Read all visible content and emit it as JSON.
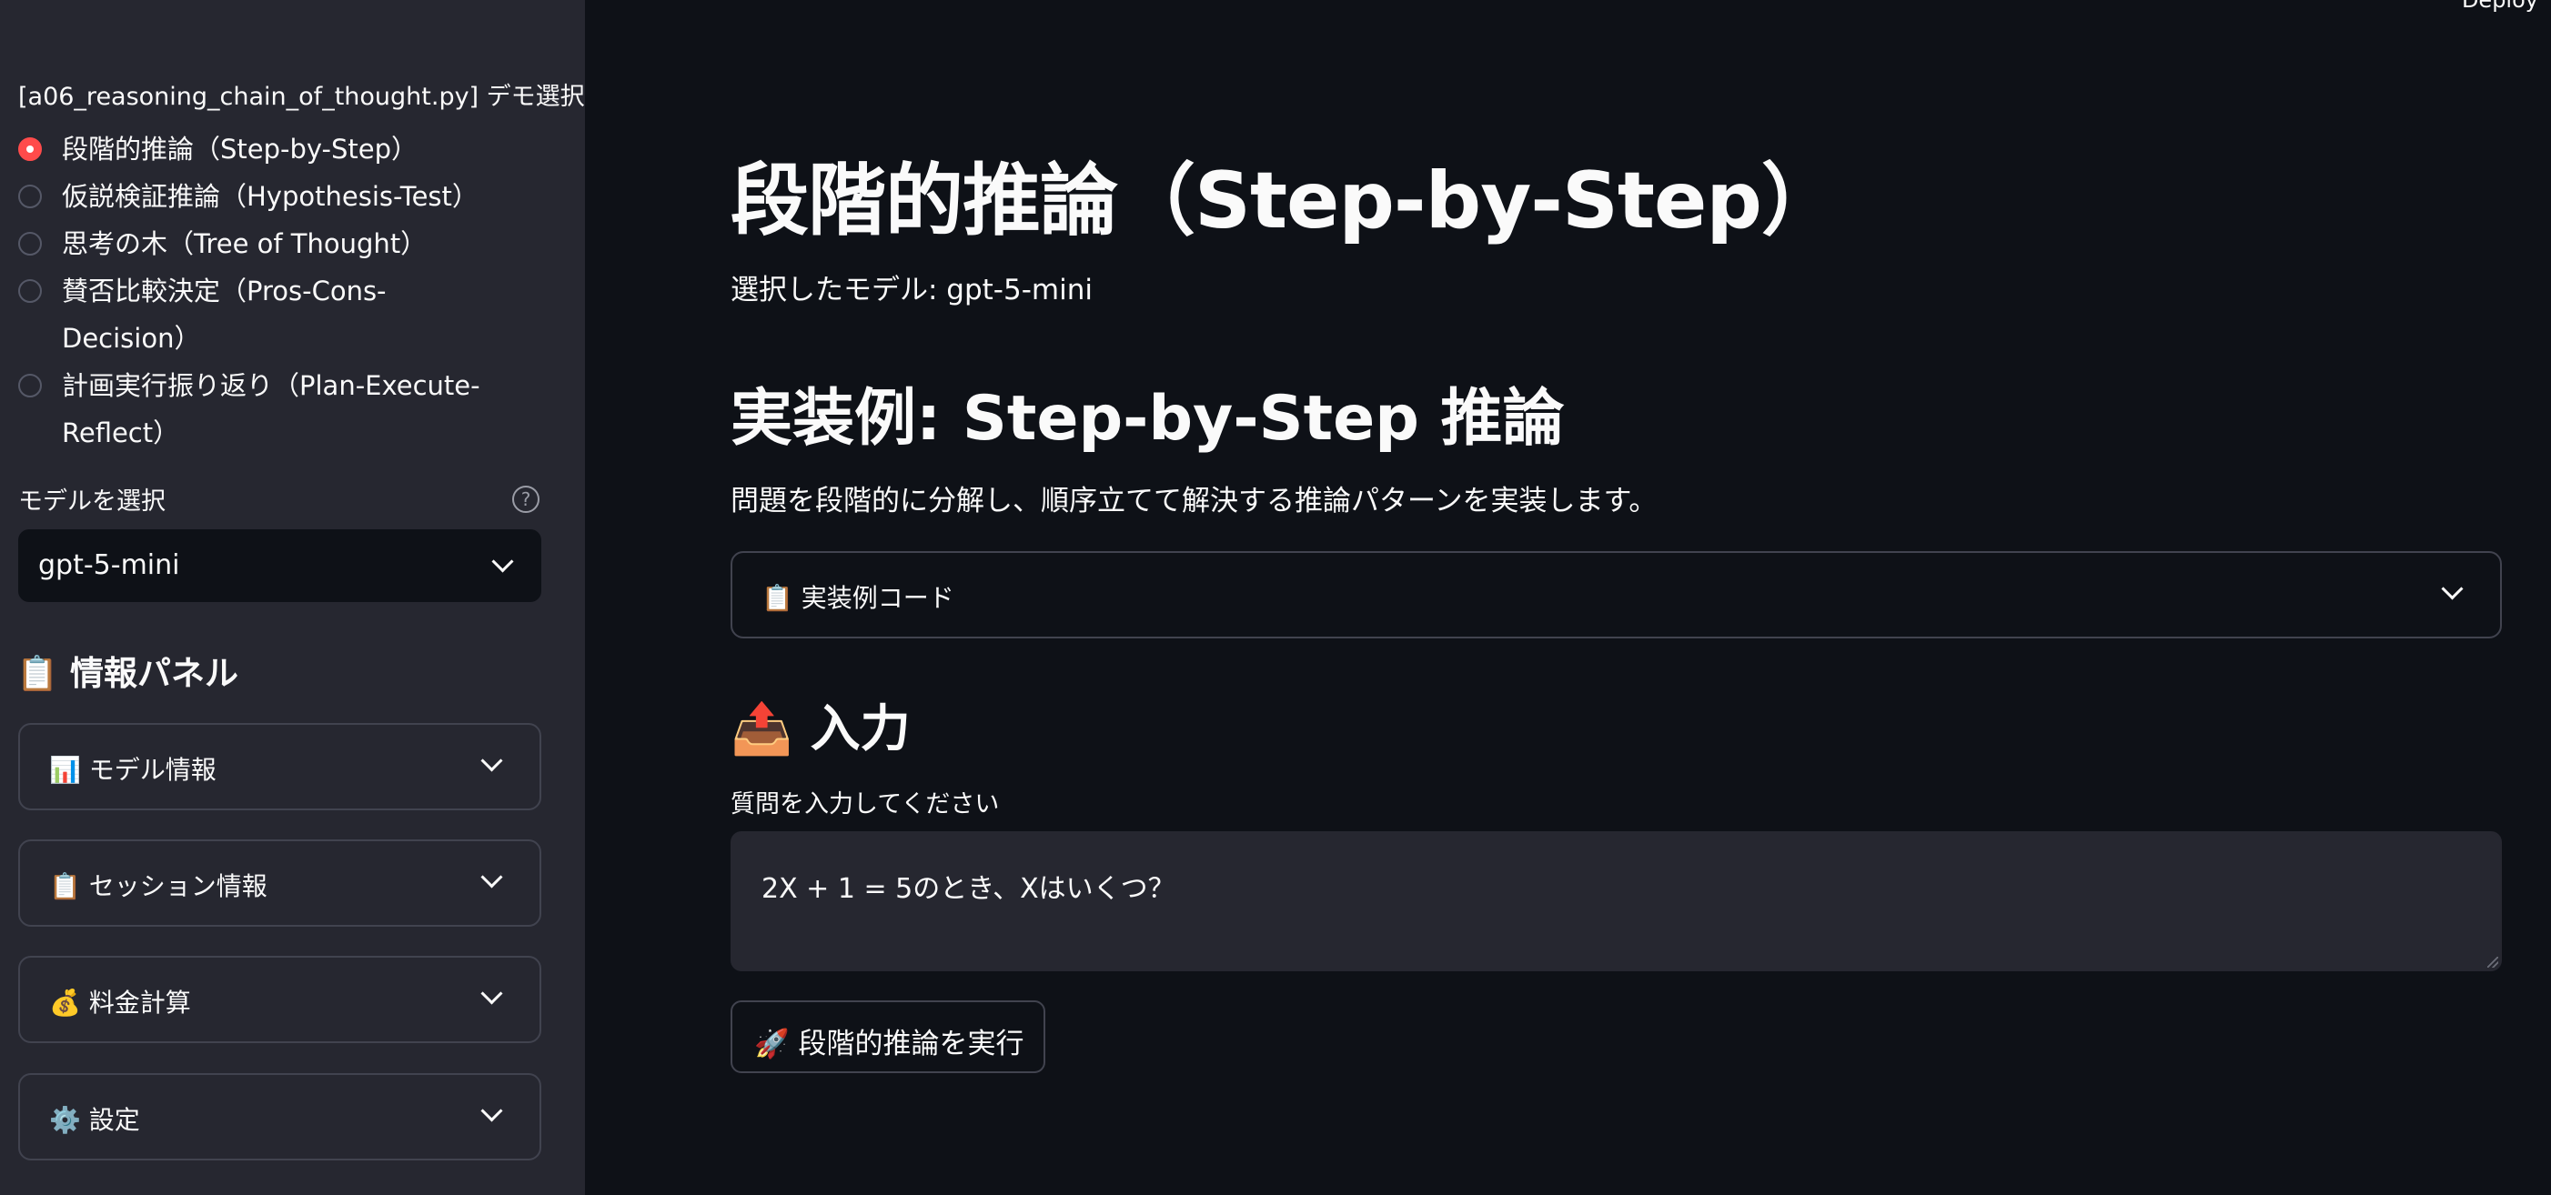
{
  "header": {
    "deploy_label": "Deploy"
  },
  "sidebar": {
    "demo_label": "[a06_reasoning_chain_of_thought.py] デモ選択",
    "demos": [
      {
        "label": "段階的推論（Step-by-Step）",
        "selected": true
      },
      {
        "label": "仮説検証推論（Hypothesis-Test）",
        "selected": false
      },
      {
        "label": "思考の木（Tree of Thought）",
        "selected": false
      },
      {
        "label": "賛否比較決定（Pros-Cons-Decision）",
        "selected": false
      },
      {
        "label": "計画実行振り返り（Plan-Execute-Reflect）",
        "selected": false
      }
    ],
    "model_label": "モデルを選択",
    "help_icon": "?",
    "model_value": "gpt-5-mini",
    "panel_title": "情報パネル",
    "panel_icon": "📋",
    "panels": [
      {
        "icon": "📊",
        "label": "モデル情報"
      },
      {
        "icon": "📋",
        "label": "セッション情報"
      },
      {
        "icon": "💰",
        "label": "料金計算"
      },
      {
        "icon": "⚙️",
        "label": "設定"
      }
    ]
  },
  "main": {
    "title": "段階的推論（Step-by-Step）",
    "selected_model": "選択したモデル: gpt-5-mini",
    "section_title": "実装例: Step-by-Step 推論",
    "description": "問題を段階的に分解し、順序立てて解決する推論パターンを実装します。",
    "code_expander": {
      "icon": "📋",
      "label": "実装例コード"
    },
    "input_heading": {
      "icon": "📤",
      "label": "入力"
    },
    "question_label": "質問を入力してください",
    "question_value": "2X + 1 = 5のとき、Xはいくつ？",
    "run_button": {
      "icon": "🚀",
      "label": "段階的推論を実行"
    }
  },
  "colors": {
    "main_bg": "#0e1117",
    "sidebar_bg": "#262730",
    "accent": "#ff4b4b",
    "border": "#41434f"
  }
}
